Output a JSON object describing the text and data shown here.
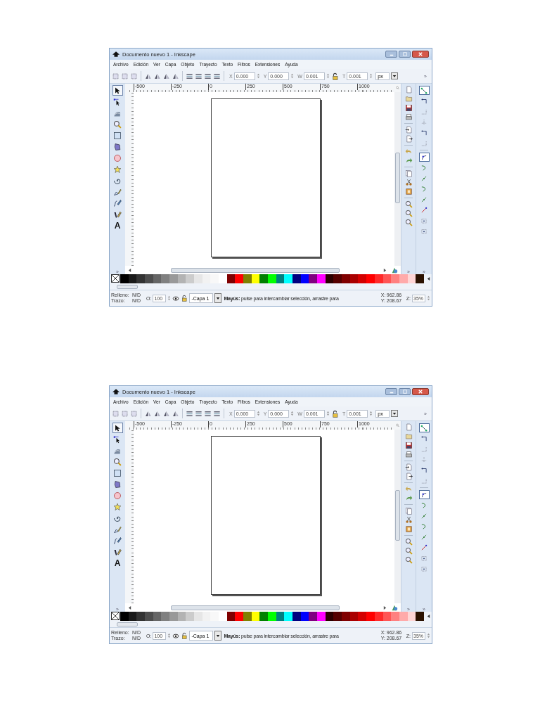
{
  "screenshots": [
    {
      "window": {
        "title": "Documento nuevo 1 - Inkscape"
      },
      "menu": [
        "Archivo",
        "Edición",
        "Ver",
        "Capa",
        "Objeto",
        "Trayecto",
        "Texto",
        "Filtros",
        "Extensiones",
        "Ayuda"
      ],
      "toolbar": {
        "fields": [
          {
            "label": "X",
            "value": "0.000"
          },
          {
            "label": "Y",
            "value": "0.000"
          },
          {
            "label": "W",
            "value": "0.001"
          },
          {
            "label": "T",
            "value": "0.001"
          }
        ],
        "unit": "px",
        "overflow": "»"
      },
      "ruler_labels": [
        "-500",
        "-250",
        "0",
        "250",
        "500",
        "750",
        "1000"
      ],
      "tools": [
        {
          "kind": "select",
          "selected": true
        },
        {
          "kind": "node",
          "selected": false
        },
        {
          "kind": "tweak",
          "selected": false
        },
        {
          "kind": "zoom",
          "selected": false
        },
        {
          "kind": "rect",
          "selected": false
        },
        {
          "kind": "box3d",
          "selected": false
        },
        {
          "kind": "ellipse",
          "selected": false
        },
        {
          "kind": "star",
          "selected": false
        },
        {
          "kind": "spiral",
          "selected": false
        },
        {
          "kind": "pencil",
          "selected": false
        },
        {
          "kind": "pen",
          "selected": false
        },
        {
          "kind": "calligraphy",
          "selected": false
        },
        {
          "kind": "text",
          "glyph": "A",
          "selected": false
        }
      ],
      "tools_overflow": "»",
      "commands": [
        {
          "kind": "new"
        },
        {
          "kind": "open"
        },
        {
          "kind": "save"
        },
        {
          "kind": "print"
        },
        {
          "kind": "sep"
        },
        {
          "kind": "import"
        },
        {
          "kind": "export"
        },
        {
          "kind": "sep"
        },
        {
          "kind": "undo"
        },
        {
          "kind": "redo"
        },
        {
          "kind": "sep"
        },
        {
          "kind": "duplicate"
        },
        {
          "kind": "scissors"
        },
        {
          "kind": "frame"
        },
        {
          "kind": "sep"
        },
        {
          "kind": "zoom"
        },
        {
          "kind": "zoom"
        },
        {
          "kind": "zoom"
        }
      ],
      "commands_overflow": "»",
      "snaps": [
        {
          "kind": "snap",
          "selected": true
        },
        {
          "kind": "corner",
          "selected": false
        },
        {
          "kind": "dotted-corner",
          "selected": false
        },
        {
          "kind": "dotted-line",
          "selected": false
        },
        {
          "kind": "corner",
          "selected": false
        },
        {
          "kind": "dotted-corner",
          "selected": false
        },
        {
          "kind": "sep"
        },
        {
          "kind": "curve-node",
          "selected": true
        },
        {
          "kind": "green-curve",
          "selected": false
        },
        {
          "kind": "green-line",
          "selected": false
        },
        {
          "kind": "green-curve",
          "selected": false
        },
        {
          "kind": "green-line",
          "selected": false
        },
        {
          "kind": "red-line",
          "selected": false
        },
        {
          "kind": "dot-box",
          "selected": false
        },
        {
          "kind": "dot-box",
          "selected": false
        }
      ],
      "snaps_overflow": "»",
      "palette": [
        {
          "color": "#000000"
        },
        {
          "color": "#1a1a1a"
        },
        {
          "color": "#333333"
        },
        {
          "color": "#4d4d4d"
        },
        {
          "color": "#666666"
        },
        {
          "color": "#808080"
        },
        {
          "color": "#999999"
        },
        {
          "color": "#b3b3b3"
        },
        {
          "color": "#cccccc"
        },
        {
          "color": "#e6e6e6"
        },
        {
          "color": "#f2f2f2"
        },
        {
          "color": "#f8f8f8"
        },
        {
          "color": "#ffffff"
        },
        {
          "color": "#800000"
        },
        {
          "color": "#ff0000"
        },
        {
          "color": "#808000"
        },
        {
          "color": "#ffff00"
        },
        {
          "color": "#008000"
        },
        {
          "color": "#00ff00"
        },
        {
          "color": "#008080"
        },
        {
          "color": "#00ffff"
        },
        {
          "color": "#000080"
        },
        {
          "color": "#0000ff"
        },
        {
          "color": "#800080"
        },
        {
          "color": "#ff00ff"
        },
        {
          "color": "#2b0000"
        },
        {
          "color": "#550000"
        },
        {
          "color": "#800000"
        },
        {
          "color": "#aa0000"
        },
        {
          "color": "#d40000"
        },
        {
          "color": "#ff0000"
        },
        {
          "color": "#ff2a2a"
        },
        {
          "color": "#ff5555"
        },
        {
          "color": "#ff8080"
        },
        {
          "color": "#ffaaaa"
        },
        {
          "color": "#ffd5d5"
        },
        {
          "color": "#2b1100"
        }
      ],
      "status": {
        "fill_label": "Relleno:",
        "fill_value": "N/D",
        "stroke_label": "Trazo:",
        "stroke_value": "N/D",
        "opacity_label": "O:",
        "opacity_value": "100",
        "layer": "-Capa 1",
        "message": "**Mayús:** pulse para intercambiar selección, arrastre para",
        "x_label": "X:",
        "x_value": "962.86",
        "y_label": "Y:",
        "y_value": "208.67",
        "zoom_label": "Z:",
        "zoom_value": "35%"
      }
    },
    {
      "window": {
        "title": "Documento nuevo 1 - Inkscape"
      },
      "menu": [
        "Archivo",
        "Edición",
        "Ver",
        "Capa",
        "Objeto",
        "Trayecto",
        "Texto",
        "Filtros",
        "Extensiones",
        "Ayuda"
      ],
      "toolbar": {
        "fields": [
          {
            "label": "X",
            "value": "0.000"
          },
          {
            "label": "Y",
            "value": "0.000"
          },
          {
            "label": "W",
            "value": "0.001"
          },
          {
            "label": "T",
            "value": "0.001"
          }
        ],
        "unit": "px",
        "overflow": "»"
      },
      "ruler_labels": [
        "-500",
        "-250",
        "0",
        "250",
        "500",
        "750",
        "1000"
      ],
      "tools": [
        {
          "kind": "select",
          "selected": true
        },
        {
          "kind": "node",
          "selected": false
        },
        {
          "kind": "tweak",
          "selected": false
        },
        {
          "kind": "zoom",
          "selected": false
        },
        {
          "kind": "rect",
          "selected": false
        },
        {
          "kind": "box3d",
          "selected": false
        },
        {
          "kind": "ellipse",
          "selected": false
        },
        {
          "kind": "star",
          "selected": false
        },
        {
          "kind": "spiral",
          "selected": false
        },
        {
          "kind": "pencil",
          "selected": false
        },
        {
          "kind": "pen",
          "selected": false
        },
        {
          "kind": "calligraphy",
          "selected": false
        },
        {
          "kind": "text",
          "glyph": "A",
          "selected": false
        }
      ],
      "tools_overflow": "»",
      "commands": [
        {
          "kind": "new"
        },
        {
          "kind": "open"
        },
        {
          "kind": "save"
        },
        {
          "kind": "print"
        },
        {
          "kind": "sep"
        },
        {
          "kind": "import"
        },
        {
          "kind": "export"
        },
        {
          "kind": "sep"
        },
        {
          "kind": "undo"
        },
        {
          "kind": "redo"
        },
        {
          "kind": "sep"
        },
        {
          "kind": "duplicate"
        },
        {
          "kind": "scissors"
        },
        {
          "kind": "frame"
        },
        {
          "kind": "sep"
        },
        {
          "kind": "zoom"
        },
        {
          "kind": "zoom"
        },
        {
          "kind": "zoom"
        }
      ],
      "commands_overflow": "»",
      "snaps": [
        {
          "kind": "snap",
          "selected": true
        },
        {
          "kind": "corner",
          "selected": false
        },
        {
          "kind": "dotted-corner",
          "selected": false
        },
        {
          "kind": "dotted-line",
          "selected": false
        },
        {
          "kind": "corner",
          "selected": false
        },
        {
          "kind": "dotted-corner",
          "selected": false
        },
        {
          "kind": "sep"
        },
        {
          "kind": "curve-node",
          "selected": true
        },
        {
          "kind": "green-curve",
          "selected": false
        },
        {
          "kind": "green-line",
          "selected": false
        },
        {
          "kind": "green-curve",
          "selected": false
        },
        {
          "kind": "green-line",
          "selected": false
        },
        {
          "kind": "red-line",
          "selected": false
        },
        {
          "kind": "dot-box",
          "selected": false
        },
        {
          "kind": "dot-box",
          "selected": false
        }
      ],
      "snaps_overflow": "»",
      "palette": [
        {
          "color": "#000000"
        },
        {
          "color": "#1a1a1a"
        },
        {
          "color": "#333333"
        },
        {
          "color": "#4d4d4d"
        },
        {
          "color": "#666666"
        },
        {
          "color": "#808080"
        },
        {
          "color": "#999999"
        },
        {
          "color": "#b3b3b3"
        },
        {
          "color": "#cccccc"
        },
        {
          "color": "#e6e6e6"
        },
        {
          "color": "#f2f2f2"
        },
        {
          "color": "#f8f8f8"
        },
        {
          "color": "#ffffff"
        },
        {
          "color": "#800000"
        },
        {
          "color": "#ff0000"
        },
        {
          "color": "#808000"
        },
        {
          "color": "#ffff00"
        },
        {
          "color": "#008000"
        },
        {
          "color": "#00ff00"
        },
        {
          "color": "#008080"
        },
        {
          "color": "#00ffff"
        },
        {
          "color": "#000080"
        },
        {
          "color": "#0000ff"
        },
        {
          "color": "#800080"
        },
        {
          "color": "#ff00ff"
        },
        {
          "color": "#2b0000"
        },
        {
          "color": "#550000"
        },
        {
          "color": "#800000"
        },
        {
          "color": "#aa0000"
        },
        {
          "color": "#d40000"
        },
        {
          "color": "#ff0000"
        },
        {
          "color": "#ff2a2a"
        },
        {
          "color": "#ff5555"
        },
        {
          "color": "#ff8080"
        },
        {
          "color": "#ffaaaa"
        },
        {
          "color": "#ffd5d5"
        },
        {
          "color": "#2b1100"
        }
      ],
      "status": {
        "fill_label": "Relleno:",
        "fill_value": "N/D",
        "stroke_label": "Trazo:",
        "stroke_value": "N/D",
        "opacity_label": "O:",
        "opacity_value": "100",
        "layer": "-Capa 1",
        "message": "**Mayús:** pulse para intercambiar selección, arrastre para",
        "x_label": "X:",
        "x_value": "962.86",
        "y_label": "Y:",
        "y_value": "208.67",
        "zoom_label": "Z:",
        "zoom_value": "35%"
      }
    }
  ]
}
